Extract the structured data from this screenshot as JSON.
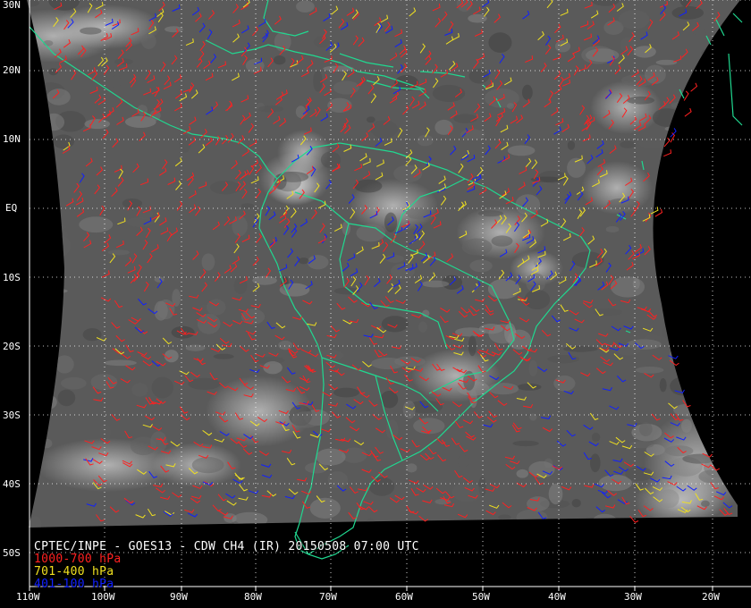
{
  "map": {
    "title": "CPTEC/INPE - GOES13 - CDW CH4 (IR) 20150508 07:00 UTC",
    "lat_labels": [
      "30N",
      "20N",
      "10N",
      "EQ",
      "10S",
      "20S",
      "30S",
      "40S",
      "50S"
    ],
    "lon_labels": [
      "110W",
      "100W",
      "90W",
      "80W",
      "70W",
      "60W",
      "50W",
      "40W",
      "30W",
      "20W"
    ],
    "legend": [
      {
        "label": "1000-700 hPa",
        "color": "#ff2020"
      },
      {
        "label": "701-400 hPa",
        "color": "#f0e020"
      },
      {
        "label": "401-100 hPa",
        "color": "#1020ff"
      }
    ],
    "coastline_color": "#20d890",
    "grid_color": "#ffffff"
  }
}
